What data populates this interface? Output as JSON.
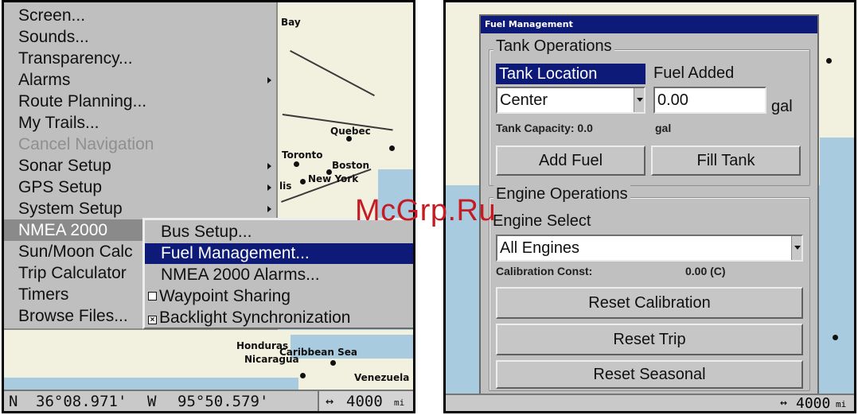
{
  "left": {
    "map_labels": {
      "bay": "Bay",
      "quebec": "Quebec",
      "toronto": "Toronto",
      "boston": "Boston",
      "new_york": "New York",
      "lis": "lis",
      "honduras": "Honduras",
      "caribbean_sea": "Caribbean Sea",
      "nicaragua": "Nicaragua",
      "venezuela": "Venezuela"
    },
    "menu_items": [
      {
        "label": "Screen...",
        "disabled": false,
        "submenu": false
      },
      {
        "label": "Sounds...",
        "disabled": false,
        "submenu": false
      },
      {
        "label": "Transparency...",
        "disabled": false,
        "submenu": false
      },
      {
        "label": "Alarms",
        "disabled": false,
        "submenu": true
      },
      {
        "label": "Route Planning...",
        "disabled": false,
        "submenu": false
      },
      {
        "label": "My Trails...",
        "disabled": false,
        "submenu": false
      },
      {
        "label": "Cancel Navigation",
        "disabled": true,
        "submenu": false
      },
      {
        "label": "Sonar Setup",
        "disabled": false,
        "submenu": true
      },
      {
        "label": "GPS Setup",
        "disabled": false,
        "submenu": true
      },
      {
        "label": "System Setup",
        "disabled": false,
        "submenu": true
      },
      {
        "label": "NMEA 2000",
        "disabled": false,
        "submenu": false
      },
      {
        "label": "Sun/Moon Calc",
        "disabled": false,
        "submenu": false
      },
      {
        "label": "Trip Calculator",
        "disabled": false,
        "submenu": false
      },
      {
        "label": "Timers",
        "disabled": false,
        "submenu": false
      },
      {
        "label": "Browse Files...",
        "disabled": false,
        "submenu": false
      }
    ],
    "submenu_items": [
      {
        "label": "Bus Setup..."
      },
      {
        "label": "Fuel Management..."
      },
      {
        "label": "NMEA 2000 Alarms..."
      },
      {
        "label": "Waypoint Sharing",
        "checked": false
      },
      {
        "label": "Backlight Synchronization",
        "checked": true
      }
    ],
    "status": {
      "lat_hemi": "N",
      "lat": "36°08.971'",
      "lon_hemi": "W",
      "lon": "95°50.579'",
      "range_value": "4000",
      "range_unit": "mi"
    }
  },
  "right": {
    "dialog_title": "Fuel Management",
    "tank_ops": {
      "title": "Tank Operations",
      "tank_location_label": "Tank Location",
      "fuel_added_label": "Fuel Added",
      "location_value": "Center",
      "fuel_added_value": "0.00",
      "fuel_unit": "gal",
      "capacity_label": "Tank Capacity: 0.0",
      "capacity_unit": "gal",
      "add_fuel": "Add Fuel",
      "fill_tank": "Fill Tank"
    },
    "engine_ops": {
      "title": "Engine Operations",
      "engine_select_label": "Engine Select",
      "engine_value": "All Engines",
      "calibration_label": "Calibration Const:",
      "calibration_value": "0.00 (C)",
      "reset_calibration": "Reset Calibration",
      "reset_trip": "Reset Trip",
      "reset_seasonal": "Reset Seasonal"
    },
    "status_range": "4000",
    "status_unit": "mi"
  },
  "watermark": "McGrp.Ru",
  "colors": {
    "highlight": "#0e1a78",
    "menu_bg": "#bfbfbf",
    "watermark": "#c61b22"
  }
}
